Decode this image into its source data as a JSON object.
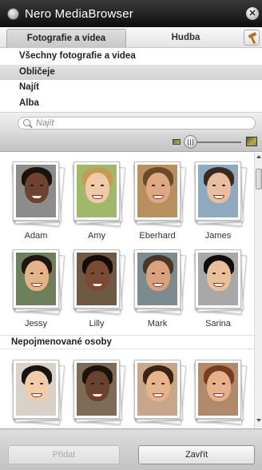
{
  "window": {
    "title": "Nero MediaBrowser",
    "close_glyph": "✕"
  },
  "tabs": [
    {
      "label": "Fotografie a videa",
      "selected": true
    },
    {
      "label": "Hudba",
      "selected": false
    }
  ],
  "tools_icon": "hammer-icon",
  "categories": [
    {
      "label": "Všechny fotografie a videa",
      "selected": false
    },
    {
      "label": "Obličeje",
      "selected": true
    },
    {
      "label": "Najít",
      "selected": false
    },
    {
      "label": "Alba",
      "selected": false
    }
  ],
  "search": {
    "placeholder": "Najít",
    "value": ""
  },
  "zoom": {
    "level": 0.1
  },
  "people": [
    {
      "name": "Adam"
    },
    {
      "name": "Amy"
    },
    {
      "name": "Eberhard"
    },
    {
      "name": "James"
    },
    {
      "name": "Jessy"
    },
    {
      "name": "Lilly"
    },
    {
      "name": "Mark"
    },
    {
      "name": "Sarina"
    }
  ],
  "unnamed_section": {
    "label": "Nepojmenované osoby",
    "count_visible": 4
  },
  "footer": {
    "add_label": "Přidat",
    "add_enabled": false,
    "close_label": "Zavřít"
  },
  "colors": {
    "titlebar": "#1a1a1a",
    "selected_row": "#d9d9d9",
    "disabled_text": "#a8a8a8"
  }
}
